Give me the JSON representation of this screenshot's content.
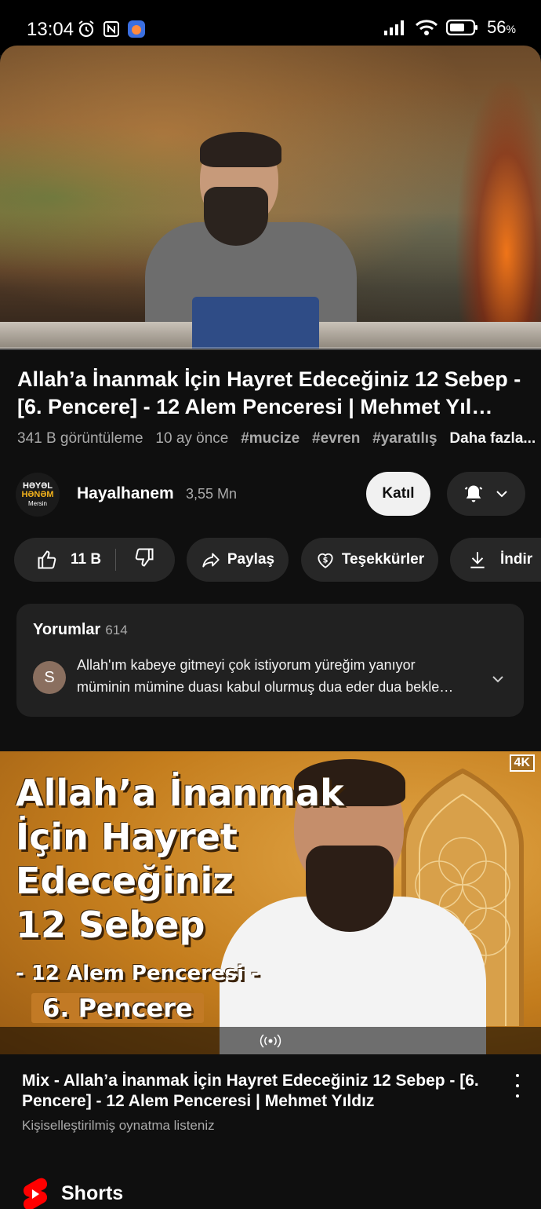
{
  "status_bar": {
    "time": "13:04",
    "battery": "56"
  },
  "video": {
    "title": "Allah’a İnanmak İçin Hayret Edeceğiniz 12 Sebep - [6. Pencere] - 12 Alem Penceresi | Mehmet Yıl…",
    "views": "341 B görüntüleme",
    "age": "10 ay önce",
    "tags": [
      "#mucize",
      "#evren",
      "#yaratılış"
    ],
    "more": "Daha fazla..."
  },
  "channel": {
    "avatar_line1": "HƏYƏL",
    "avatar_line2": "HƏNƏM",
    "avatar_line3": "Mersin",
    "name": "Hayalhanem",
    "subs": "3,55 Mn",
    "join": "Katıl"
  },
  "actions": {
    "likes": "11 B",
    "share": "Paylaş",
    "thanks": "Teşekkürler",
    "download": "İndir"
  },
  "comments": {
    "title": "Yorumlar",
    "count": "614",
    "avatar_letter": "S",
    "line1": "Allah'ım kabeye gitmeyi çok istiyorum yüreğim yanıyor",
    "line2": "müminin mümine duası kabul olurmuş dua eder dua bekle…"
  },
  "mix": {
    "thumb_line1": "Allah’a İnanmak",
    "thumb_line2": "İçin Hayret",
    "thumb_line3": "Edeceğiniz",
    "thumb_line4": "12 Sebep",
    "thumb_line5": "- 12 Alem Penceresi -",
    "thumb_line6": "6. Pencere",
    "badge": "4K",
    "title": "Mix - Allah’a İnanmak İçin Hayret Edeceğiniz 12 Sebep - [6. Pencere] - 12 Alem Penceresi | Mehmet Yıldız",
    "subtitle": "Kişiselleştirilmiş oynatma listeniz"
  },
  "shorts": {
    "label": "Shorts"
  },
  "colors": {
    "accent": "#ff0000",
    "pill_bg": "#272727",
    "bg": "#0f0f0f"
  }
}
